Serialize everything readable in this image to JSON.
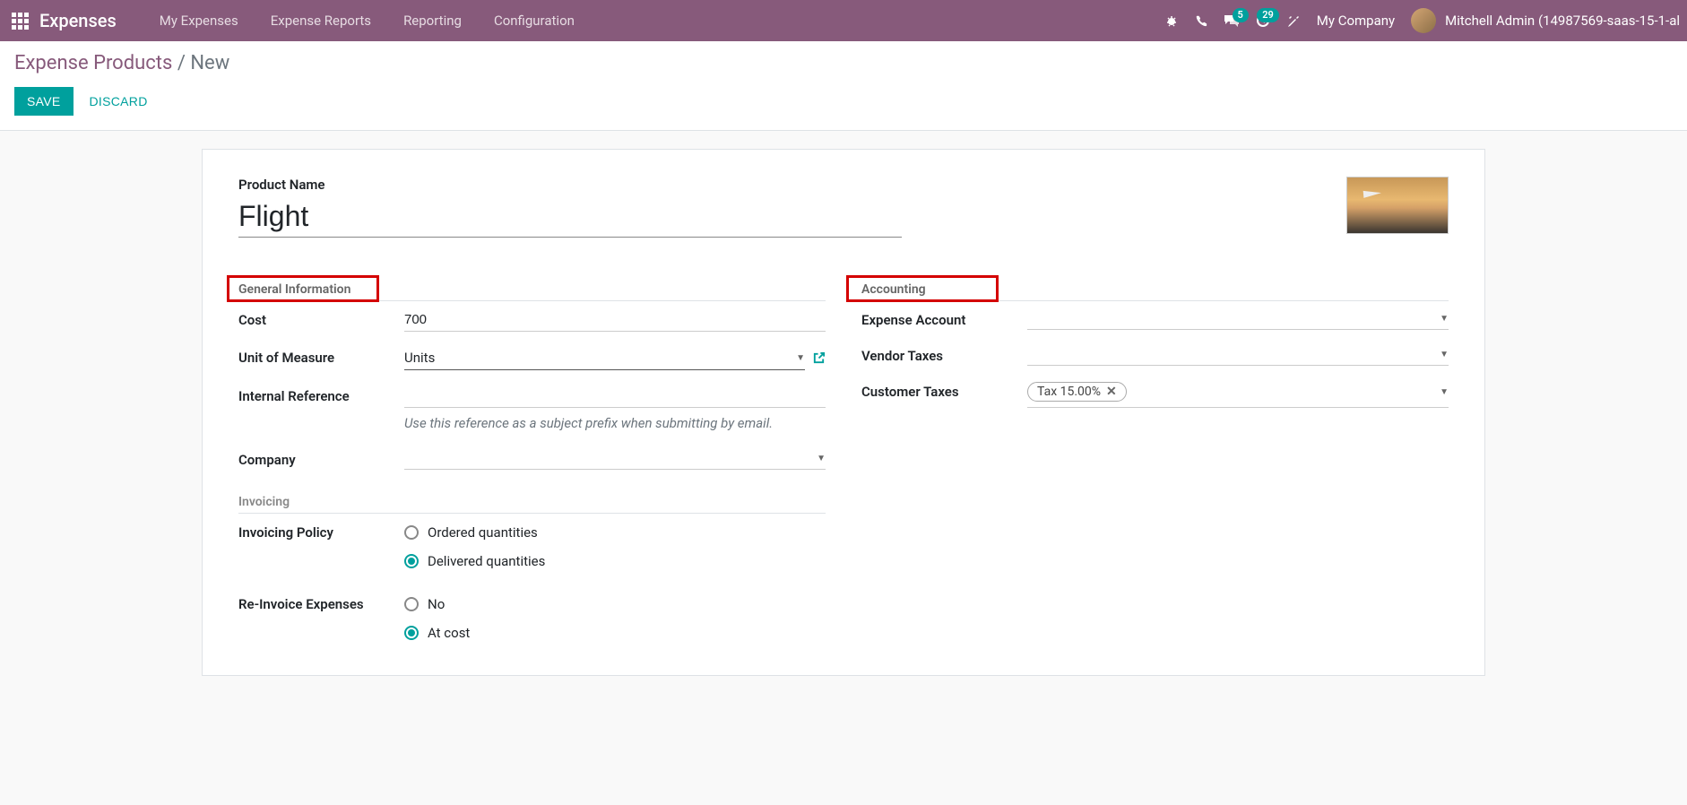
{
  "topbar": {
    "app_title": "Expenses",
    "nav": [
      "My Expenses",
      "Expense Reports",
      "Reporting",
      "Configuration"
    ],
    "messages_badge": "5",
    "activities_badge": "29",
    "company": "My Company",
    "user": "Mitchell Admin (14987569-saas-15-1-al"
  },
  "breadcrumb": {
    "parent": "Expense Products",
    "current": "New"
  },
  "actions": {
    "save": "SAVE",
    "discard": "DISCARD"
  },
  "form": {
    "product_name_label": "Product Name",
    "product_name_value": "Flight",
    "sections": {
      "general": "General Information",
      "accounting": "Accounting",
      "invoicing": "Invoicing"
    },
    "fields": {
      "cost_label": "Cost",
      "cost_value": "700",
      "uom_label": "Unit of Measure",
      "uom_value": "Units",
      "internal_ref_label": "Internal Reference",
      "internal_ref_value": "",
      "internal_ref_help": "Use this reference as a subject prefix when submitting by email.",
      "company_label": "Company",
      "invoicing_policy_label": "Invoicing Policy",
      "invoicing_policy_options": {
        "ordered": "Ordered quantities",
        "delivered": "Delivered quantities"
      },
      "reinvoice_label": "Re-Invoice Expenses",
      "reinvoice_options": {
        "no": "No",
        "atcost": "At cost"
      },
      "expense_account_label": "Expense Account",
      "vendor_taxes_label": "Vendor Taxes",
      "customer_taxes_label": "Customer Taxes",
      "customer_taxes_tag": "Tax 15.00%"
    }
  }
}
